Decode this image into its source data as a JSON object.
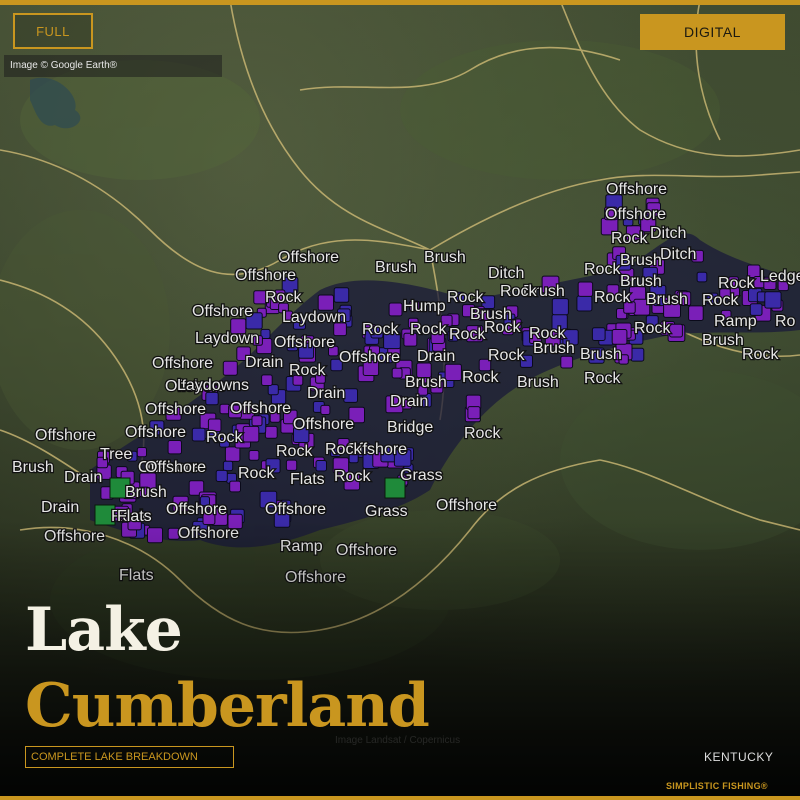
{
  "header": {
    "full_label": "FULL",
    "digital_label": "DIGITAL",
    "attribution": "Image © Google Earth®"
  },
  "title": {
    "line1": "Lake",
    "line2": "Cumberland",
    "subtitle": "COMPLETE LAKE BREAKDOWN"
  },
  "footer": {
    "state": "KENTUCKY",
    "brand": "SIMPLISTIC FISHING®",
    "watermark": "Image Landsat / Copernicus"
  },
  "colors": {
    "gold": "#c9961f",
    "marker_purple": "#7a1fb8",
    "marker_blue": "#3a2aa8",
    "marker_green": "#1f8a3a",
    "road": "#d8c27a"
  },
  "map_labels": [
    "Offshore",
    "Offshore",
    "Ditch",
    "Rock",
    "Ditch",
    "Rock",
    "Brush",
    "Rock",
    "Ledge",
    "Brush",
    "Rock",
    "Brush",
    "Ramp",
    "Ro",
    "Brush",
    "Rock",
    "Brush",
    "Offshore",
    "Brush",
    "Ditch",
    "Offshore",
    "Rock",
    "Offshore",
    "Brush",
    "Rock",
    "Rock",
    "Rock",
    "Hump",
    "Rock",
    "Brush",
    "Offshore",
    "Laydown",
    "Drain",
    "Rock",
    "Rock",
    "Rock",
    "Rock",
    "Laydown",
    "Offshore",
    "Rock",
    "Rock",
    "Brush",
    "Offshore",
    "Drain",
    "Brush",
    "Rock",
    "Offshore",
    "Rock",
    "Laydowns",
    "Drain",
    "Brush",
    "Brush",
    "Rock",
    "Offshore",
    "Offshore",
    "Drain",
    "Offshore",
    "Offshore",
    "Rock",
    "Bridge",
    "Rock",
    "Offshore",
    "Offshore",
    "Rock",
    "Rock",
    "Offshore",
    "Tree",
    "Offshore",
    "Rock",
    "Brush",
    "Drain",
    "Rock",
    "Flats",
    "Rock",
    "Grass",
    "Brush",
    "Offshore",
    "Drain",
    "Flats",
    "Offshore",
    "Offshore",
    "Grass",
    "Offshore",
    "Offshore",
    "Ramp",
    "Offshore",
    "Flats",
    "Offshore"
  ]
}
